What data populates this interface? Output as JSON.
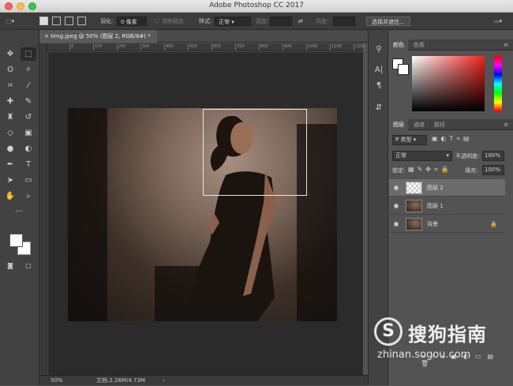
{
  "window": {
    "title": "Adobe Photoshop CC 2017"
  },
  "options_bar": {
    "feather_label": "羽化:",
    "feather_value": "0 像素",
    "antialias_label": "消除锯齿",
    "style_label": "样式:",
    "style_value": "正常",
    "width_label": "宽度:",
    "height_label": "高度:",
    "select_mask_button": "选择并遮住..."
  },
  "document": {
    "tab_title": "timg.jpeg @ 50% (图层 2, RGB/8#) *",
    "ruler_ticks": [
      "0",
      "100",
      "200",
      "300",
      "400",
      "500",
      "600",
      "700",
      "800",
      "900",
      "1000",
      "1100",
      "1200"
    ],
    "zoom": "50%",
    "doc_size": "文档:2.26M/4.73M"
  },
  "color_panel": {
    "tabs": [
      "颜色",
      "色板"
    ],
    "fg_color": "#ffffff",
    "bg_color": "#ffffff"
  },
  "layers_panel": {
    "tabs": [
      "图层",
      "通道",
      "路径"
    ],
    "filter_label": "P 类型",
    "blend_mode": "正常",
    "opacity_label": "不透明度:",
    "opacity_value": "100%",
    "lock_label": "锁定:",
    "fill_label": "填充:",
    "fill_value": "100%",
    "layers": [
      {
        "name": "图层 2",
        "selected": true
      },
      {
        "name": "图层 1",
        "selected": false
      },
      {
        "name": "背景",
        "selected": false
      }
    ]
  },
  "watermark": {
    "brand_text": "搜狗指南",
    "url": "zhinan.sogou.com",
    "badge_letter": "S"
  }
}
